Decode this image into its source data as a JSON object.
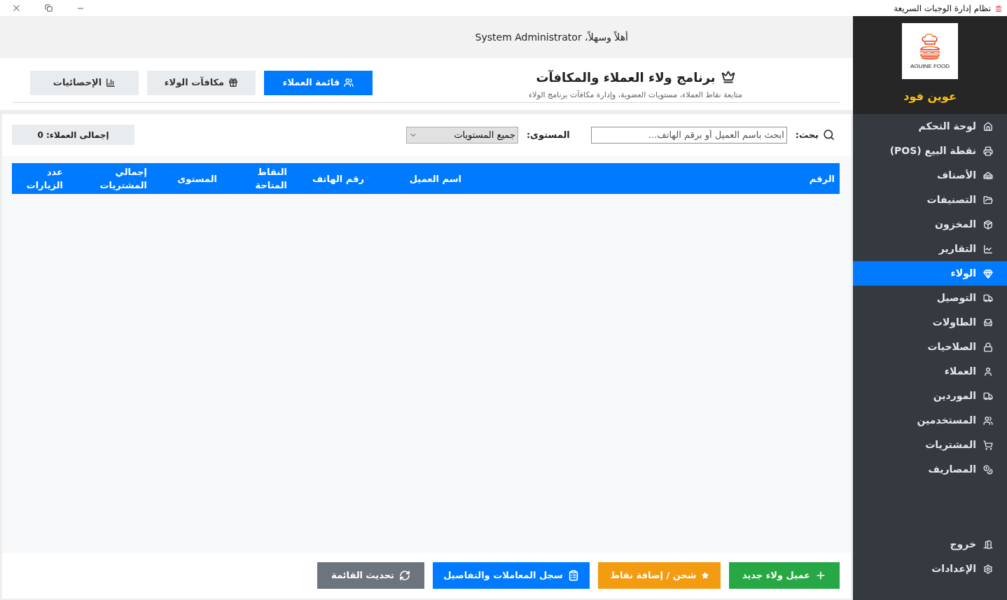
{
  "window": {
    "title": "نظام إدارة الوجبات السريعة"
  },
  "sidebar": {
    "logo_text": "AOUINE FOOD",
    "brand": "عوين فود",
    "items": [
      {
        "label": "لوحة التحكم",
        "selected": false
      },
      {
        "label": "نقطة البيع (POS)",
        "selected": false
      },
      {
        "label": "الأصناف",
        "selected": false
      },
      {
        "label": "التصنيفات",
        "selected": false
      },
      {
        "label": "المخزون",
        "selected": false
      },
      {
        "label": "التقارير",
        "selected": false
      },
      {
        "label": "الولاء",
        "selected": true
      },
      {
        "label": "التوصيل",
        "selected": false
      },
      {
        "label": "الطاولات",
        "selected": false
      },
      {
        "label": "الصلاحيات",
        "selected": false
      },
      {
        "label": "العملاء",
        "selected": false
      },
      {
        "label": "الموردين",
        "selected": false
      },
      {
        "label": "المستخدمين",
        "selected": false
      },
      {
        "label": "المشتريات",
        "selected": false
      },
      {
        "label": "المصاريف",
        "selected": false
      }
    ],
    "bottom_items": [
      {
        "label": "خروج",
        "selected": false
      },
      {
        "label": "الإعدادات",
        "selected": false
      }
    ]
  },
  "header": {
    "greeting": "أهلاً وسهلاً، System Administrator"
  },
  "page": {
    "title": "برنامج ولاء العملاء والمكافآت",
    "subtitle": "متابعة نقاط العملاء، مستويات العضوية، وإدارة مكافآت برنامج الولاء",
    "tabs": [
      {
        "label": "قائمة العملاء",
        "selected": true
      },
      {
        "label": "مكافآت الولاء",
        "selected": false
      },
      {
        "label": "الإحصائيات",
        "selected": false
      }
    ]
  },
  "filters": {
    "search": {
      "label": "بحث:",
      "placeholder": "ابحث باسم العميل أو برقم الهاتف..."
    },
    "level": {
      "label": "المستوى:",
      "value": "جميع المستويات"
    },
    "total": "إجمالى العملاء: 0"
  },
  "table": {
    "columns": [
      "الرقم",
      "اسم العميل",
      "رقم الهاتف",
      "النقاط المتاحة",
      "المستوى",
      "إجمالي المشتريات",
      "عدد الزيارات"
    ]
  },
  "actions": [
    {
      "label": "عميل ولاء جديد",
      "color": "#28a745"
    },
    {
      "label": "شحن / إضافة نقاط",
      "color": "#f39c12"
    },
    {
      "label": "سجل المعاملات والتفاصيل",
      "color": "#007bff"
    },
    {
      "label": "تحديث القائمة",
      "color": "#6c757d"
    }
  ]
}
